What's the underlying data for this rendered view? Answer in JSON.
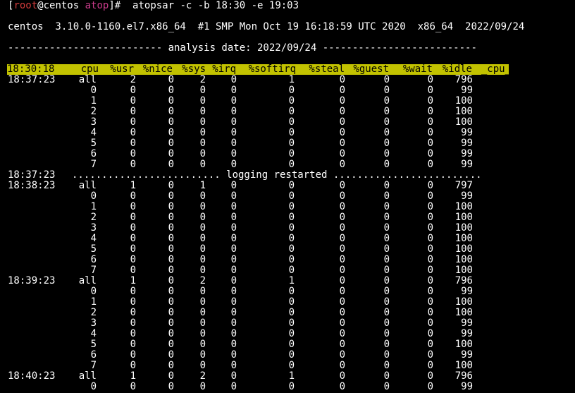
{
  "prompt": {
    "open": "[",
    "user": "root",
    "at": "@centos ",
    "dir": "atop",
    "close": "]#",
    "command": "  atopsar -c -b 18:30 -e 19:03"
  },
  "sysinfo": "centos  3.10.0-1160.el7.x86_64  #1 SMP Mon Oct 19 16:18:59 UTC 2020  x86_64  2022/09/24",
  "analysis_line": "-------------------------- analysis date: 2022/09/24 --------------------------",
  "header": [
    "18:30:18",
    "cpu",
    "%usr",
    "%nice",
    "%sys",
    "%irq",
    "%softirq",
    "%steal",
    "%guest",
    "%wait",
    "%idle",
    "_cpu_"
  ],
  "restart_time": "18:37:23",
  "restart_text": "......................... logging restarted .........................",
  "rows": [
    [
      "18:37:23",
      "all",
      "2",
      "0",
      "2",
      "0",
      "1",
      "0",
      "0",
      "0",
      "796"
    ],
    [
      "",
      "0",
      "0",
      "0",
      "0",
      "0",
      "0",
      "0",
      "0",
      "0",
      "99"
    ],
    [
      "",
      "1",
      "0",
      "0",
      "0",
      "0",
      "0",
      "0",
      "0",
      "0",
      "100"
    ],
    [
      "",
      "2",
      "0",
      "0",
      "0",
      "0",
      "0",
      "0",
      "0",
      "0",
      "100"
    ],
    [
      "",
      "3",
      "0",
      "0",
      "0",
      "0",
      "0",
      "0",
      "0",
      "0",
      "100"
    ],
    [
      "",
      "4",
      "0",
      "0",
      "0",
      "0",
      "0",
      "0",
      "0",
      "0",
      "99"
    ],
    [
      "",
      "5",
      "0",
      "0",
      "0",
      "0",
      "0",
      "0",
      "0",
      "0",
      "99"
    ],
    [
      "",
      "6",
      "0",
      "0",
      "0",
      "0",
      "0",
      "0",
      "0",
      "0",
      "99"
    ],
    [
      "",
      "7",
      "0",
      "0",
      "0",
      "0",
      "0",
      "0",
      "0",
      "0",
      "99"
    ],
    [
      "RESTART"
    ],
    [
      "18:38:23",
      "all",
      "1",
      "0",
      "1",
      "0",
      "0",
      "0",
      "0",
      "0",
      "797"
    ],
    [
      "",
      "0",
      "0",
      "0",
      "0",
      "0",
      "0",
      "0",
      "0",
      "0",
      "99"
    ],
    [
      "",
      "1",
      "0",
      "0",
      "0",
      "0",
      "0",
      "0",
      "0",
      "0",
      "100"
    ],
    [
      "",
      "2",
      "0",
      "0",
      "0",
      "0",
      "0",
      "0",
      "0",
      "0",
      "100"
    ],
    [
      "",
      "3",
      "0",
      "0",
      "0",
      "0",
      "0",
      "0",
      "0",
      "0",
      "100"
    ],
    [
      "",
      "4",
      "0",
      "0",
      "0",
      "0",
      "0",
      "0",
      "0",
      "0",
      "100"
    ],
    [
      "",
      "5",
      "0",
      "0",
      "0",
      "0",
      "0",
      "0",
      "0",
      "0",
      "100"
    ],
    [
      "",
      "6",
      "0",
      "0",
      "0",
      "0",
      "0",
      "0",
      "0",
      "0",
      "100"
    ],
    [
      "",
      "7",
      "0",
      "0",
      "0",
      "0",
      "0",
      "0",
      "0",
      "0",
      "100"
    ],
    [
      "18:39:23",
      "all",
      "1",
      "0",
      "2",
      "0",
      "1",
      "0",
      "0",
      "0",
      "796"
    ],
    [
      "",
      "0",
      "0",
      "0",
      "0",
      "0",
      "0",
      "0",
      "0",
      "0",
      "99"
    ],
    [
      "",
      "1",
      "0",
      "0",
      "0",
      "0",
      "0",
      "0",
      "0",
      "0",
      "100"
    ],
    [
      "",
      "2",
      "0",
      "0",
      "0",
      "0",
      "0",
      "0",
      "0",
      "0",
      "100"
    ],
    [
      "",
      "3",
      "0",
      "0",
      "0",
      "0",
      "0",
      "0",
      "0",
      "0",
      "99"
    ],
    [
      "",
      "4",
      "0",
      "0",
      "0",
      "0",
      "0",
      "0",
      "0",
      "0",
      "99"
    ],
    [
      "",
      "5",
      "0",
      "0",
      "0",
      "0",
      "0",
      "0",
      "0",
      "0",
      "100"
    ],
    [
      "",
      "6",
      "0",
      "0",
      "0",
      "0",
      "0",
      "0",
      "0",
      "0",
      "99"
    ],
    [
      "",
      "7",
      "0",
      "0",
      "0",
      "0",
      "0",
      "0",
      "0",
      "0",
      "100"
    ],
    [
      "18:40:23",
      "all",
      "1",
      "0",
      "2",
      "0",
      "1",
      "0",
      "0",
      "0",
      "796"
    ],
    [
      "",
      "0",
      "0",
      "0",
      "0",
      "0",
      "0",
      "0",
      "0",
      "0",
      "99"
    ]
  ]
}
